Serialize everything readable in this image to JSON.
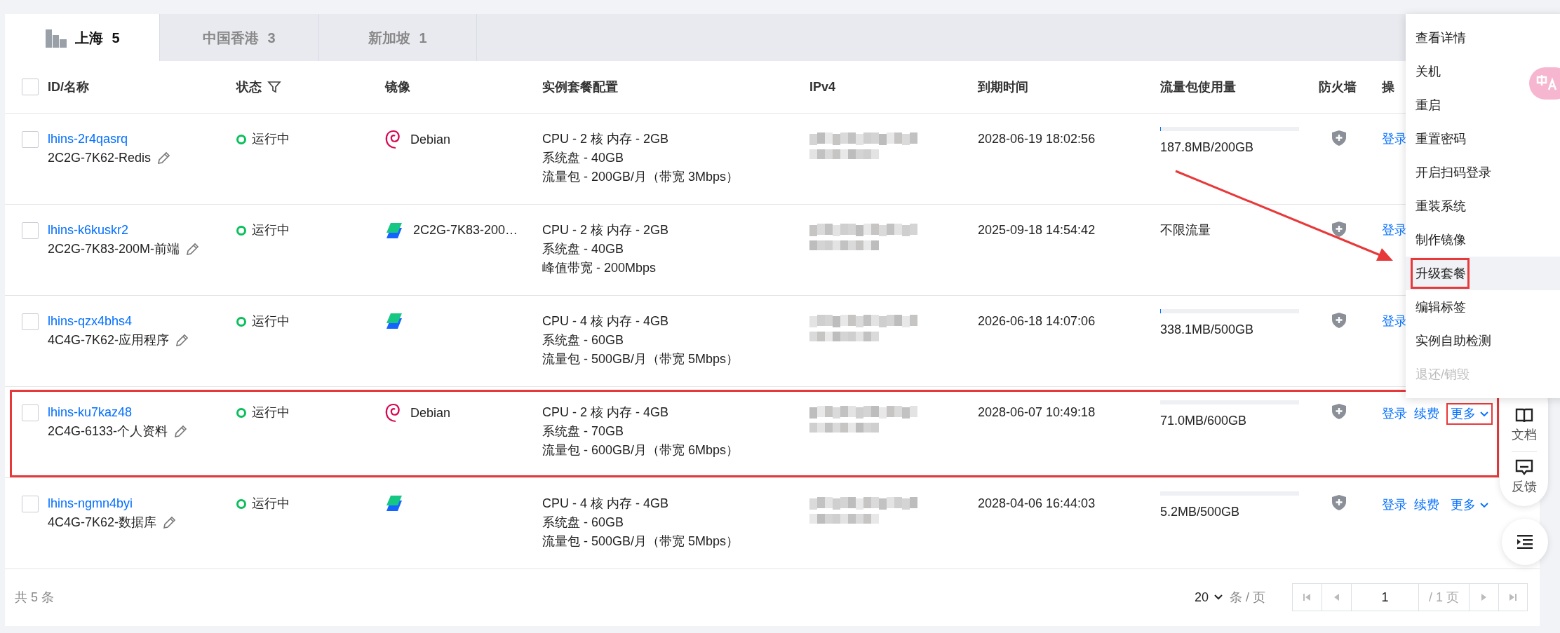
{
  "tabs": [
    {
      "kind": "icon",
      "label": "上海",
      "count": "5",
      "selected": true
    },
    {
      "kind": "plain",
      "label": "中国香港",
      "count": "3",
      "selected": false
    },
    {
      "kind": "plain",
      "label": "新加坡",
      "count": "1",
      "selected": false
    }
  ],
  "select_all": {
    "checked": false
  },
  "columns": [
    {
      "label": "ID/名称"
    },
    {
      "label": "状态",
      "filter": true
    },
    {
      "label": "镜像"
    },
    {
      "label": "实例套餐配置"
    },
    {
      "label": "IPv4"
    },
    {
      "label": "到期时间"
    },
    {
      "label": "流量包使用量"
    },
    {
      "label": "防火墙"
    },
    {
      "label": "操"
    }
  ],
  "rows": [
    {
      "checked": false,
      "highlighted": false,
      "id": "lhins-2r4qasrq",
      "name": "2C2G-7K62-Redis",
      "status": {
        "kind": "running",
        "label": "运行中"
      },
      "image": {
        "kind": "debian",
        "label": "Debian"
      },
      "config": [
        "CPU - 2 核 内存 - 2GB",
        "系统盘 - 40GB",
        "流量包 - 200GB/月（带宽 3Mbps）"
      ],
      "expiry": "2028-06-19 18:02:56",
      "traffic": {
        "text": "187.8MB/200GB",
        "level": 0.005
      },
      "actions": [
        {
          "kind": "link",
          "label": "登录"
        }
      ]
    },
    {
      "checked": false,
      "highlighted": false,
      "id": "lhins-k6kuskr2",
      "name": "2C2G-7K83-200M-前端",
      "status": {
        "kind": "running",
        "label": "运行中"
      },
      "image": {
        "kind": "lighthouse",
        "label": "2C2G-7K83-200…"
      },
      "config": [
        "CPU - 2 核 内存 - 2GB",
        "系统盘 - 40GB",
        "峰值带宽 - 200Mbps"
      ],
      "expiry": "2025-09-18 14:54:42",
      "traffic": {
        "text": "不限流量"
      },
      "actions": [
        {
          "kind": "link",
          "label": "登录"
        }
      ]
    },
    {
      "checked": false,
      "highlighted": false,
      "id": "lhins-qzx4bhs4",
      "name": "4C4G-7K62-应用程序",
      "status": {
        "kind": "running",
        "label": "运行中"
      },
      "image": {
        "kind": "lighthouse"
      },
      "config": [
        "CPU - 4 核 内存 - 4GB",
        "系统盘 - 60GB",
        "流量包 - 500GB/月（带宽 5Mbps）"
      ],
      "expiry": "2026-06-18 14:07:06",
      "traffic": {
        "text": "338.1MB/500GB",
        "level": 0.005
      },
      "actions": [
        {
          "kind": "link",
          "label": "登录"
        }
      ]
    },
    {
      "checked": false,
      "highlighted": true,
      "id": "lhins-ku7kaz48",
      "name": "2C4G-6133-个人资料",
      "status": {
        "kind": "running",
        "label": "运行中"
      },
      "image": {
        "kind": "debian",
        "label": "Debian"
      },
      "config": [
        "CPU - 2 核 内存 - 4GB",
        "系统盘 - 70GB",
        "流量包 - 600GB/月（带宽 6Mbps）"
      ],
      "expiry": "2028-06-07 10:49:18",
      "traffic": {
        "text": "71.0MB/600GB",
        "level": 0
      },
      "actions": [
        {
          "kind": "link",
          "label": "登录"
        },
        {
          "kind": "link",
          "label": "续费"
        },
        {
          "kind": "dropdown",
          "label": "更多",
          "annotated": true
        }
      ]
    },
    {
      "checked": false,
      "highlighted": false,
      "id": "lhins-ngmn4byi",
      "name": "4C4G-7K62-数据库",
      "status": {
        "kind": "running",
        "label": "运行中"
      },
      "image": {
        "kind": "lighthouse"
      },
      "config": [
        "CPU - 4 核 内存 - 4GB",
        "系统盘 - 60GB",
        "流量包 - 500GB/月（带宽 5Mbps）"
      ],
      "expiry": "2028-04-06 16:44:03",
      "traffic": {
        "text": "5.2MB/500GB",
        "level": 0
      },
      "actions": [
        {
          "kind": "link",
          "label": "登录"
        },
        {
          "kind": "link",
          "label": "续费"
        },
        {
          "kind": "dropdown",
          "label": "更多",
          "annotated": false
        }
      ]
    }
  ],
  "footer": {
    "total": "共 5 条",
    "page_size": "20",
    "page_size_unit": "条 / 页",
    "page": "1",
    "page_total": "/ 1 页"
  },
  "menu": {
    "items": [
      {
        "label": "查看详情",
        "selected": false,
        "disabled": false,
        "annotated": false
      },
      {
        "label": "关机",
        "selected": false,
        "disabled": false,
        "annotated": false
      },
      {
        "label": "重启",
        "selected": false,
        "disabled": false,
        "annotated": false
      },
      {
        "label": "重置密码",
        "selected": false,
        "disabled": false,
        "annotated": false
      },
      {
        "label": "开启扫码登录",
        "selected": false,
        "disabled": false,
        "annotated": false
      },
      {
        "label": "重装系统",
        "selected": false,
        "disabled": false,
        "annotated": false
      },
      {
        "label": "制作镜像",
        "selected": false,
        "disabled": false,
        "annotated": false
      },
      {
        "label": "升级套餐",
        "selected": true,
        "disabled": false,
        "annotated": true
      },
      {
        "label": "编辑标签",
        "selected": false,
        "disabled": false,
        "annotated": false
      },
      {
        "label": "实例自助检测",
        "selected": false,
        "disabled": false,
        "annotated": false
      },
      {
        "label": "退还/销毁",
        "selected": false,
        "disabled": true,
        "annotated": false
      }
    ]
  },
  "side_tools": [
    {
      "kind": "docs",
      "label": "文档"
    },
    {
      "kind": "feedback",
      "label": "反馈"
    }
  ]
}
